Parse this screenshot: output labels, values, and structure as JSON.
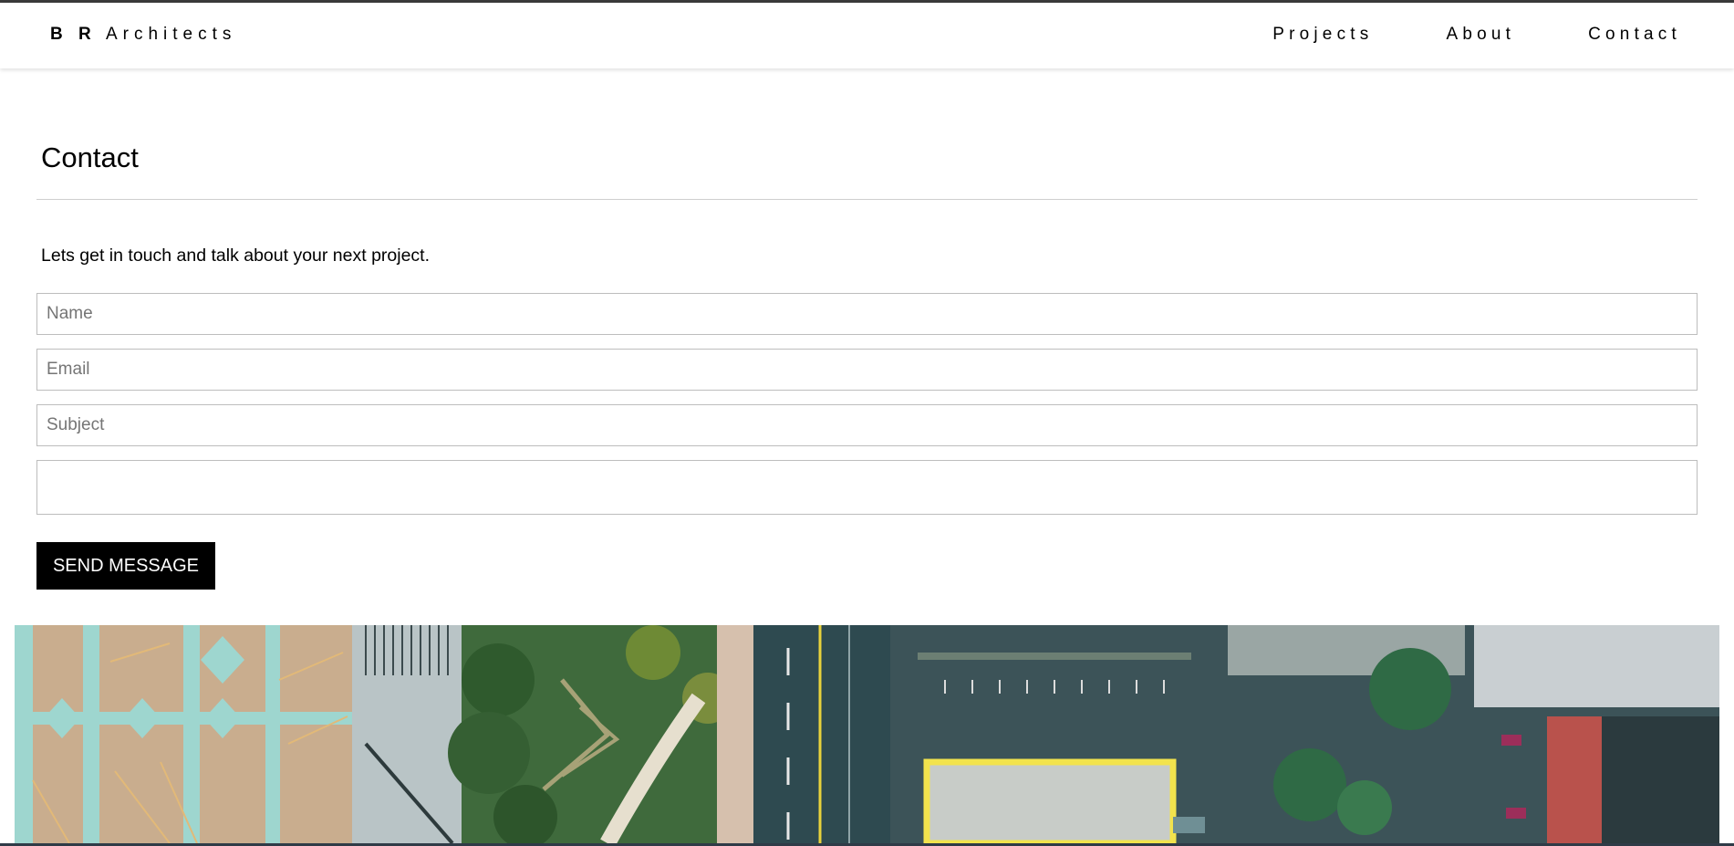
{
  "header": {
    "brand_strong": "B R",
    "brand_rest": "Architects",
    "nav": [
      {
        "label": "Projects"
      },
      {
        "label": "About"
      },
      {
        "label": "Contact"
      }
    ]
  },
  "main": {
    "title": "Contact",
    "intro": "Lets get in touch and talk about your next project.",
    "form": {
      "name_placeholder": "Name",
      "email_placeholder": "Email",
      "subject_placeholder": "Subject",
      "message_placeholder": "",
      "send_label": "SEND MESSAGE"
    }
  },
  "banner": {
    "image_subject": "aerial view of city street, plaza and parking lots"
  }
}
